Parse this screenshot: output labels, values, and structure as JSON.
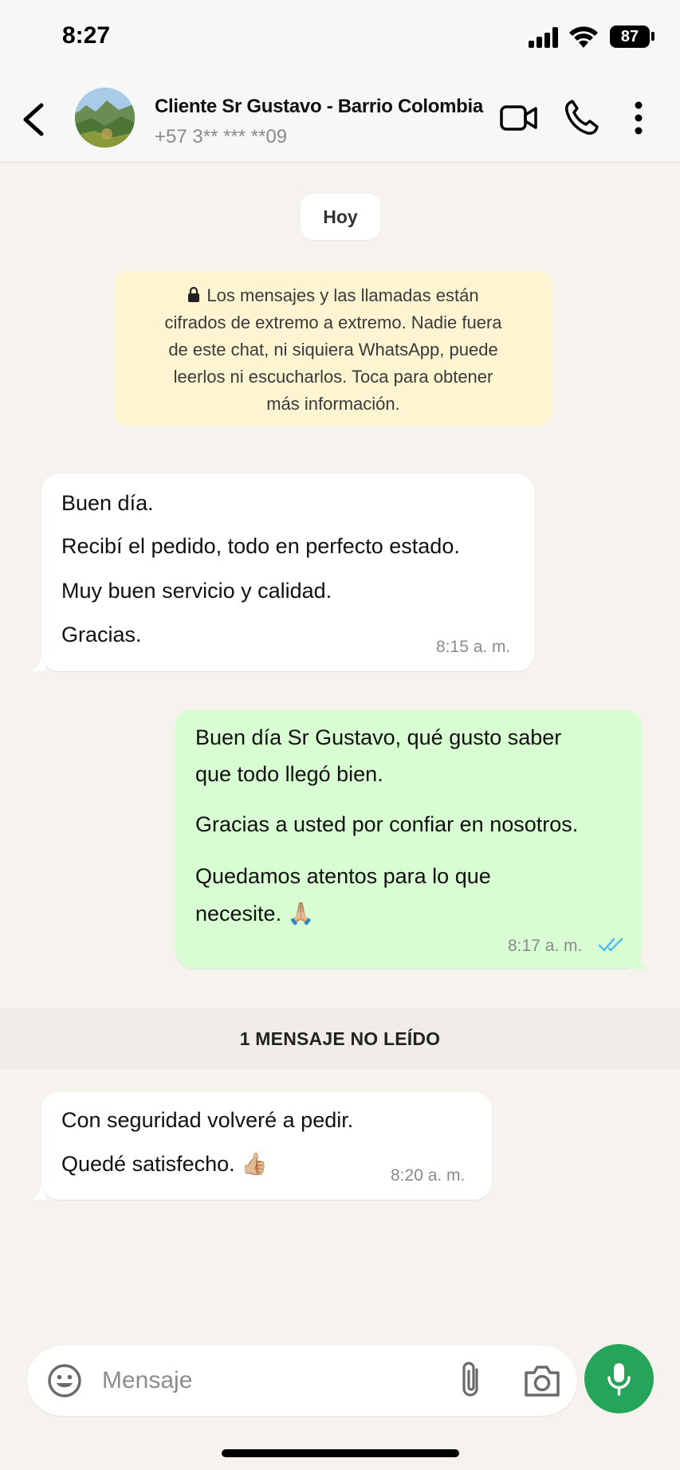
{
  "status_bar": {
    "time": "8:27",
    "battery": "87"
  },
  "header": {
    "contact_name": "Cliente  Sr Gustavo - Barrio Colombia",
    "contact_phone": "+57 3** *** **09"
  },
  "chat": {
    "date_chip": "Hoy",
    "e2e_notice": [
      "Los mensajes y las llamadas están",
      "cifrados de extremo a extremo. Nadie fuera",
      "de este chat, ni siquiera WhatsApp, puede",
      "leerlos ni escucharlos. Toca para obtener",
      "más información."
    ],
    "messages": [
      {
        "direction": "incoming",
        "lines": [
          "Buen día.",
          "Recibí el pedido, todo en perfecto estado.",
          "Muy buen servicio y calidad.",
          "Gracias."
        ],
        "time": "8:15 a. m."
      },
      {
        "direction": "outgoing",
        "lines": [
          "Buen día Sr Gustavo, qué gusto saber",
          "que todo llegó bien.",
          "Gracias a usted por confiar en nosotros.",
          "Quedamos atentos para lo que",
          "necesite. 🙏🏼"
        ],
        "time": "8:17 a. m.",
        "status": "read"
      },
      {
        "direction": "incoming",
        "lines": [
          "Con seguridad volveré a pedir.",
          "Quedé satisfecho. 👍🏼"
        ],
        "time": "8:20 a. m."
      }
    ],
    "unread_label": "1 MENSAJE NO LEÍDO"
  },
  "composer": {
    "placeholder": "Mensaje"
  },
  "colors": {
    "incoming_bubble": "#ffffff",
    "outgoing_bubble": "#d9fdd3",
    "notice_bg": "#fdf4d2",
    "mic_button": "#25a55a",
    "read_ticks": "#53bdeb"
  },
  "icons": [
    "back-icon",
    "video-call-icon",
    "phone-icon",
    "more-vertical-icon",
    "lock-icon",
    "double-check-icon",
    "emoji-icon",
    "paperclip-icon",
    "camera-icon",
    "microphone-icon"
  ]
}
